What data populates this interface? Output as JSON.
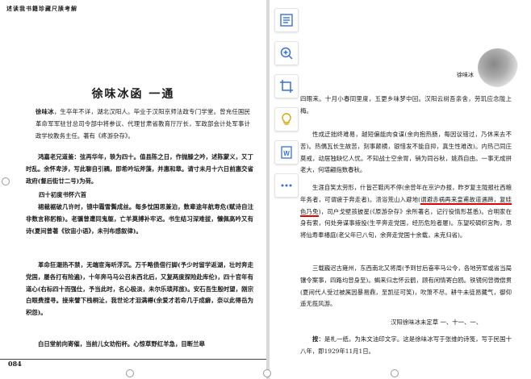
{
  "left": {
    "running_head": "述读我书籍珍藏尺牍考解",
    "title": "徐味冰函  一通",
    "intro_name": "徐味冰",
    "intro": "，生卒年不详，湖北汉阳人。毕业于汉阳京师法政专门学堂。曾充任国民革命军军驻甘总司令部中将参议、代理甘肃省教育厅厅长，军政部会计处军事计政学校教务主任。著有《疼游杂存》。",
    "p1": "鸿嘉老兄道鉴：弦再华年，轶为四十。值县陈之日，作抛滕之吟，述陈蒙义，又丁时乱。余怀卑涉，写此聊自引耦，即希吟坛斧藻，并惠和章。请寸未月十六日前惠交省政府(督后街廿二号)为荷。",
    "p2": "四十初度书怀六首",
    "p3": "裙裁裾破几许时，镜中霜雪鬓成丝。每多忱国思兼泊，数辈途年航寿危(赋诗自注非数言称躬粮)。老骥曾遭同鬼躯，亡羊莫搏补牢迟。书生结习深难拔，懒佩高吟又有诗(夏间曾著《钦宙小语》，未刊布感叙律)。",
    "p4": "革命狂潮热不禁，无端宦海听浮沉。万千略债借行脚(予少时留学返湖，壮时奔走党国，屡各打有险遍)，十年奔马马公召未西北后，又复两度探险赴库伦)，四十官年有道心(右标四十而强仕，予当此时，名心极淡，未尔乐琐邦旅)。安石吾生殷时望，刚宗白眼费搜寻。接来譬下栈桐沚，我世论才泪满樽(余爱才若命几于成癖，奈以此得岳为积怨)。",
    "p5": "白日堂前向寄催，当前儿女劝衔杯。心惊草野红羊急，目断兰皋",
    "page_number": "084"
  },
  "right": {
    "p1": "四眼来。十月小春同里度，五更乡味梦中回。汉阳云树吾亲舍，劳玑应念陇上梅。",
    "p2": "性成迂拙终难易，越短偏能肉食谋(余向抱热肠，每因议错过，乃休来去不苦)。热偶瓦长生故苦，刻事颠横，银惜发不能自抑，真生性难改)。内热己同庄莫戒，动居独缺忆人忧。不知战士空余胃，销为同谷秋，姚燕自由。一事无成拼老大，何堪翩指数春秋。",
    "p3_a": "生涯自笑太劳形，什皆芒鞋丙不停(余曾年在京沪办报，昨岁复主陇报社西粮年务者，可谓疲于奔走者)。溃浴荒山入避地(",
    "p3_hl": "谓避赤祸再来皇甫故道遇蹄，复娃色乃免",
    "p3_b": ")，司户戈壁孩披星(《原游杂存》余所著名，记行役情形甚悉)。合明家在身有索，何处旁谋事掖投(生平奔走党国，经历危险者屡)。东望咬碉织宫陶，思将仙寿奉椿庭(老父年已八旬，余奔走党国十余载，未克归省)。",
    "p4": "三载巍迟古雍州，东西南北又将周(予到甘后奋率马公令，各地劳军或省当局镶令案事，四路均曾身至)。蝎来归志怀云鹤，顾有闲情寄白鸥。铁镜何曾微偿贯(夏间代人受过被属因暴易鼎，至凯征可笑)，吹箫不尽。耕牛未徒昂藏气，御仰遥无揽风游。",
    "sign": "汉阳徐味冰未定草  一、十一、一、",
    "note_label": "按",
    "note": "：是札一纸，为朱文油印文字。这是徐味冰写于张维的诗笺，写于民国十八年，即1929年11月1日。",
    "badge": "徐味冰"
  },
  "toolbar": {
    "icons": [
      "text-lines-icon",
      "zoom-in-icon",
      "crop-icon",
      "lightbulb-icon",
      "word-doc-icon",
      "more-icon"
    ]
  },
  "colors": {
    "highlight_underline": "#e00000",
    "toolbar_icon": "#3b6fd8"
  }
}
